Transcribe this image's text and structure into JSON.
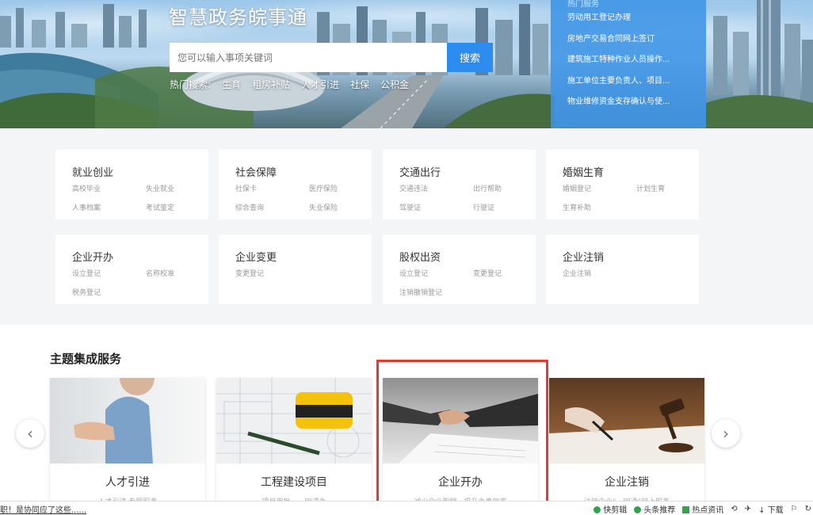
{
  "hero": {
    "title": "智慧政务皖事通",
    "search_placeholder": "您可以输入事项关键词",
    "search_button": "搜索",
    "hot_search_label": "热门搜索:",
    "hot_search_terms": [
      "生育",
      "租房补贴",
      "人才引进",
      "社保",
      "公积金"
    ]
  },
  "hot_services": {
    "title": "热门服务",
    "items": [
      "劳动用工登记办理",
      "房地产交易合同网上签订",
      "建筑施工特种作业人员操作...",
      "施工单位主要负责人、项目...",
      "物业维修资金支存确认与使..."
    ]
  },
  "categories": [
    {
      "title": "就业创业",
      "links": [
        "高校毕业",
        "失业就业",
        "人事档案",
        "考试鉴定"
      ]
    },
    {
      "title": "社会保障",
      "links": [
        "社保卡",
        "医疗保险",
        "综合查询",
        "失业保险"
      ]
    },
    {
      "title": "交通出行",
      "links": [
        "交通违法",
        "出行帮助",
        "驾驶证",
        "行驶证"
      ]
    },
    {
      "title": "婚姻生育",
      "links": [
        "婚姻登记",
        "计划生育",
        "生育补助"
      ]
    },
    {
      "title": "企业开办",
      "links": [
        "设立登记",
        "名称校准",
        "税务登记"
      ]
    },
    {
      "title": "企业变更",
      "links": [
        "变更登记"
      ]
    },
    {
      "title": "股权出资",
      "links": [
        "设立登记",
        "变更登记",
        "注销撤销登记"
      ]
    },
    {
      "title": "企业注销",
      "links": [
        "企业注销"
      ]
    }
  ],
  "theme": {
    "title": "主题集成服务",
    "cards": [
      {
        "name": "人才引进",
        "sub": "人才引进 专题服务"
      },
      {
        "name": "工程建设项目",
        "sub": "项目审批，一网通办"
      },
      {
        "name": "企业开办",
        "sub": "减少企业跑腿，提升办事效率"
      },
      {
        "name": "企业注销",
        "sub": "注销企业“一网通”网上服务"
      }
    ]
  },
  "statusbar": {
    "left_text": "职！是协同应了这些......",
    "items": [
      "快剪辑",
      "头条推荐",
      "热点资讯",
      "下载"
    ]
  },
  "colors": {
    "accent": "#2d8cf0",
    "highlight": "#e53935",
    "hot_panel": "#3d94e6"
  }
}
